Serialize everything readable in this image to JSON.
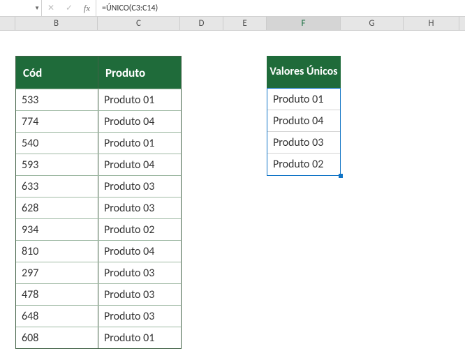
{
  "formula_bar": {
    "namebox": "",
    "formula": "=ÚNICO(C3:C14)"
  },
  "column_headers": {
    "B": "B",
    "C": "C",
    "D": "D",
    "E": "E",
    "F": "F",
    "G": "G",
    "H": "H"
  },
  "table1": {
    "header": {
      "cod": "Cód",
      "produto": "Produto"
    },
    "rows": [
      {
        "cod": "533",
        "produto": "Produto 01"
      },
      {
        "cod": "774",
        "produto": "Produto 04"
      },
      {
        "cod": "540",
        "produto": "Produto 01"
      },
      {
        "cod": "593",
        "produto": "Produto 04"
      },
      {
        "cod": "633",
        "produto": "Produto 03"
      },
      {
        "cod": "628",
        "produto": "Produto 03"
      },
      {
        "cod": "934",
        "produto": "Produto 02"
      },
      {
        "cod": "810",
        "produto": "Produto 04"
      },
      {
        "cod": "297",
        "produto": "Produto 03"
      },
      {
        "cod": "478",
        "produto": "Produto 03"
      },
      {
        "cod": "648",
        "produto": "Produto 03"
      },
      {
        "cod": "608",
        "produto": "Produto 01"
      }
    ]
  },
  "table2": {
    "header": "Valores Únicos",
    "rows": [
      "Produto 01",
      "Produto 04",
      "Produto 03",
      "Produto 02"
    ]
  }
}
